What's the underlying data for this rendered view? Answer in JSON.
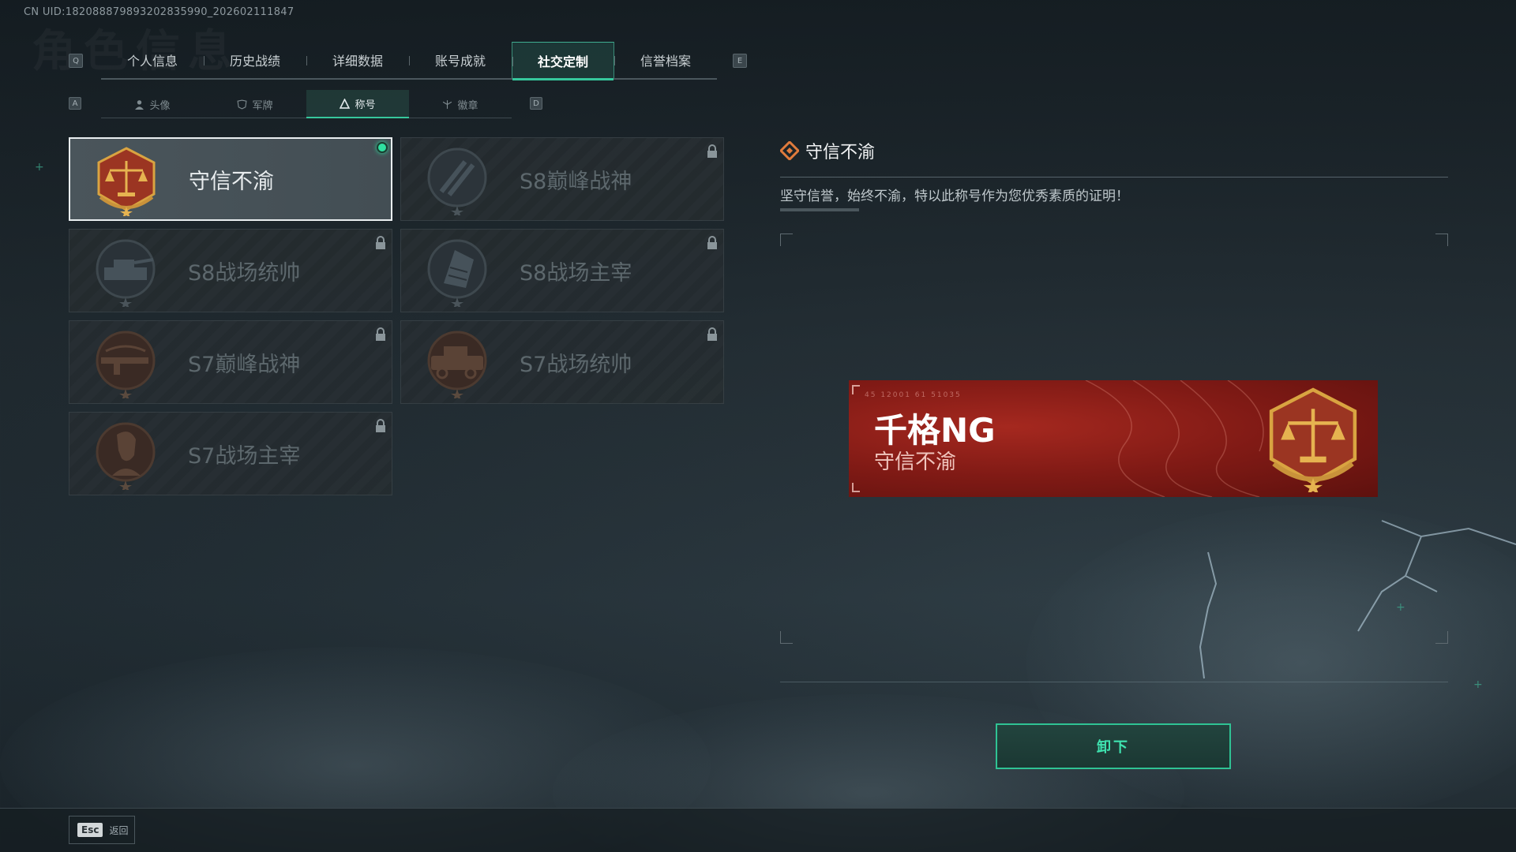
{
  "uid_text": "CN UID:182088879893202835990_202602111847",
  "tabs": {
    "key_left": "Q",
    "key_right": "E",
    "items": [
      {
        "label": "个人信息"
      },
      {
        "label": "历史战绩"
      },
      {
        "label": "详细数据"
      },
      {
        "label": "账号成就"
      },
      {
        "label": "社交定制"
      },
      {
        "label": "信誉档案"
      }
    ],
    "active_index": 4
  },
  "subtabs": {
    "key_left": "A",
    "key_right": "D",
    "items": [
      {
        "label": "头像",
        "icon": "person-icon"
      },
      {
        "label": "军牌",
        "icon": "dogtag-icon"
      },
      {
        "label": "称号",
        "icon": "triangle-icon"
      },
      {
        "label": "徽章",
        "icon": "badge-icon"
      }
    ],
    "active_index": 2
  },
  "titles": [
    {
      "name": "守信不渝",
      "emblem": "scales-emblem",
      "locked": false,
      "equipped": true
    },
    {
      "name": "S8巅峰战神",
      "emblem": "stripes-emblem",
      "locked": true
    },
    {
      "name": "S8战场统帅",
      "emblem": "tank-emblem",
      "locked": true
    },
    {
      "name": "S8战场主宰",
      "emblem": "building-emblem",
      "locked": true
    },
    {
      "name": "S7巅峰战神",
      "emblem": "rifle-emblem",
      "locked": true
    },
    {
      "name": "S7战场统帅",
      "emblem": "vehicle-emblem",
      "locked": true
    },
    {
      "name": "S7战场主宰",
      "emblem": "soldier-emblem",
      "locked": true
    }
  ],
  "detail": {
    "title": "守信不渝",
    "description": "坚守信誉，始终不渝，特以此称号作为您优秀素质的证明！"
  },
  "preview": {
    "player_name": "千格NG",
    "title": "守信不渝",
    "code": "45 12001  61 51035"
  },
  "buttons": {
    "unequip": "卸下",
    "esc_key": "Esc",
    "esc_label": "返回"
  },
  "colors": {
    "accent": "#36c79c",
    "preview_red": "#a5281f",
    "emblem_gold": "#d9a441"
  }
}
